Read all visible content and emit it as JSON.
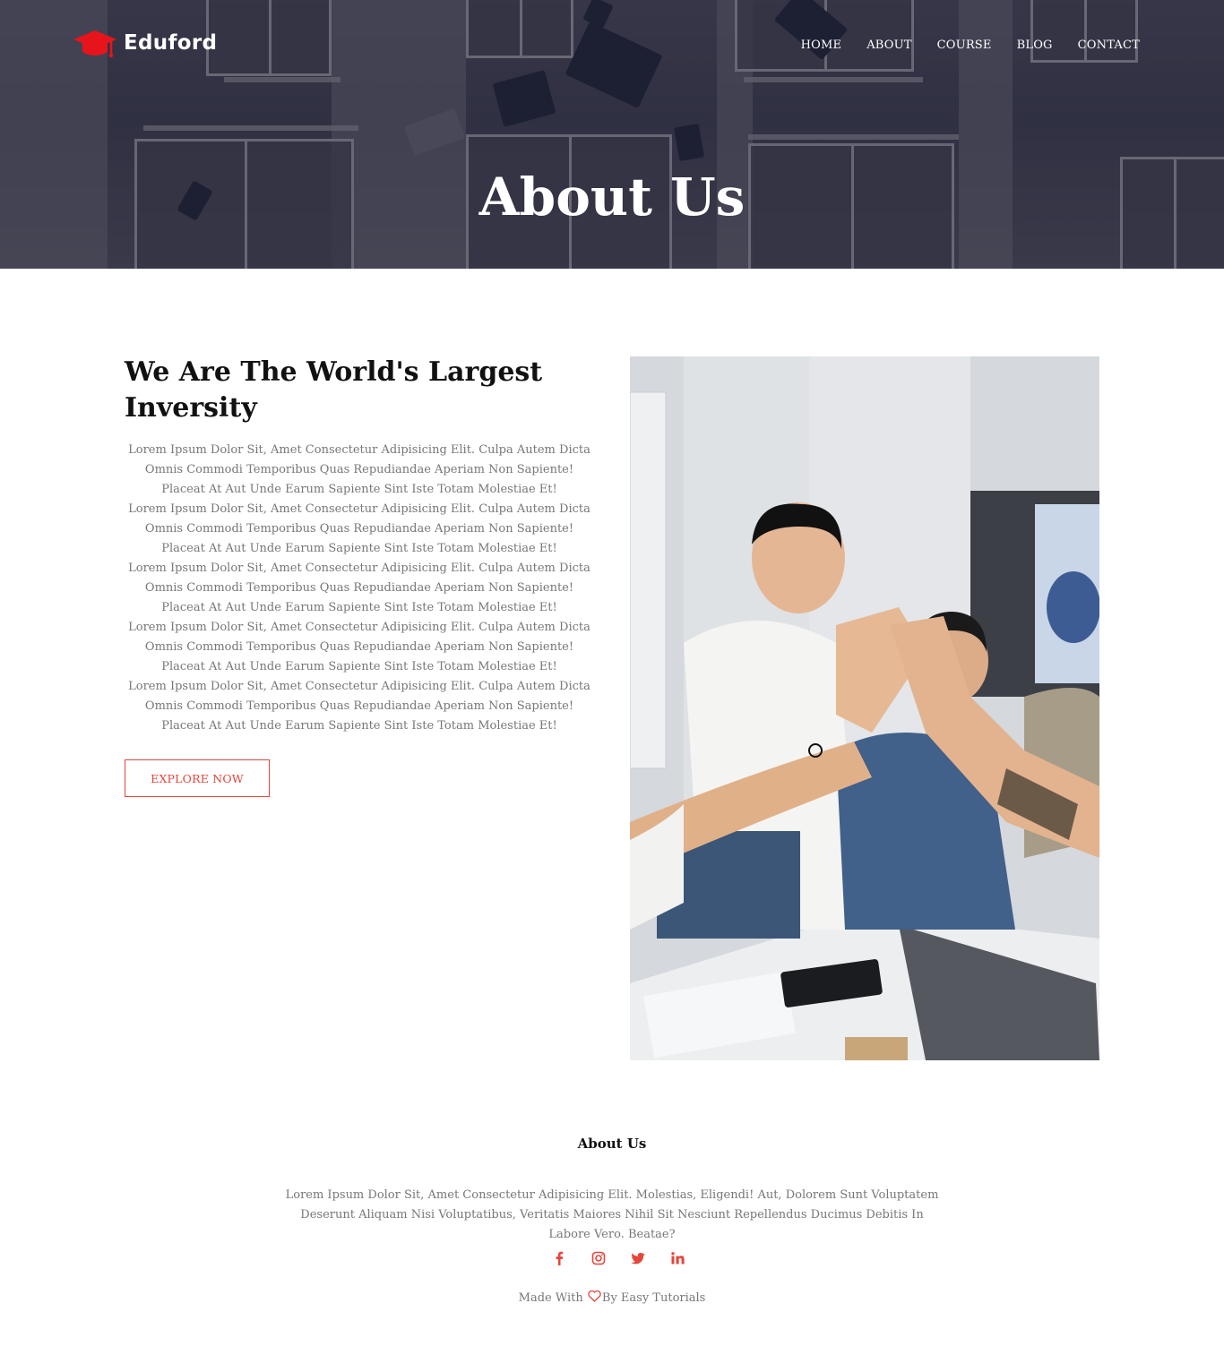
{
  "brand": {
    "name": "Eduford",
    "accent": "#e4463b"
  },
  "nav": {
    "items": [
      {
        "label": "HOME"
      },
      {
        "label": "ABOUT"
      },
      {
        "label": "COURSE"
      },
      {
        "label": "BLOG"
      },
      {
        "label": "CONTACT"
      }
    ]
  },
  "hero": {
    "title": "About Us"
  },
  "about": {
    "heading": "We Are The World's Largest Inversity",
    "paragraphs": [
      "Lorem Ipsum Dolor Sit, Amet Consectetur Adipisicing Elit. Culpa Autem Dicta Omnis Commodi Temporibus Quas Repudiandae Aperiam Non Sapiente! Placeat At Aut Unde Earum Sapiente Sint Iste Totam Molestiae Et!",
      "Lorem Ipsum Dolor Sit, Amet Consectetur Adipisicing Elit. Culpa Autem Dicta Omnis Commodi Temporibus Quas Repudiandae Aperiam Non Sapiente! Placeat At Aut Unde Earum Sapiente Sint Iste Totam Molestiae Et!",
      "Lorem Ipsum Dolor Sit, Amet Consectetur Adipisicing Elit. Culpa Autem Dicta Omnis Commodi Temporibus Quas Repudiandae Aperiam Non Sapiente! Placeat At Aut Unde Earum Sapiente Sint Iste Totam Molestiae Et!",
      "Lorem Ipsum Dolor Sit, Amet Consectetur Adipisicing Elit. Culpa Autem Dicta Omnis Commodi Temporibus Quas Repudiandae Aperiam Non Sapiente! Placeat At Aut Unde Earum Sapiente Sint Iste Totam Molestiae Et!",
      "Lorem Ipsum Dolor Sit, Amet Consectetur Adipisicing Elit. Culpa Autem Dicta Omnis Commodi Temporibus Quas Repudiandae Aperiam Non Sapiente! Placeat At Aut Unde Earum Sapiente Sint Iste Totam Molestiae Et!"
    ],
    "button_label": "EXPLORE NOW"
  },
  "footer": {
    "title": "About Us",
    "text": "Lorem Ipsum Dolor Sit, Amet Consectetur Adipisicing Elit. Molestias, Eligendi! Aut, Dolorem Sunt Voluptatem Deserunt Aliquam Nisi Voluptatibus, Veritatis Maiores Nihil Sit Nesciunt Repellendus Ducimus Debitis In Labore Vero. Beatae?",
    "socials": [
      {
        "icon": "facebook-icon"
      },
      {
        "icon": "instagram-icon"
      },
      {
        "icon": "twitter-icon"
      },
      {
        "icon": "linkedin-icon"
      }
    ],
    "credit_prefix": "Made With",
    "credit_suffix": "By Easy Tutorials"
  }
}
